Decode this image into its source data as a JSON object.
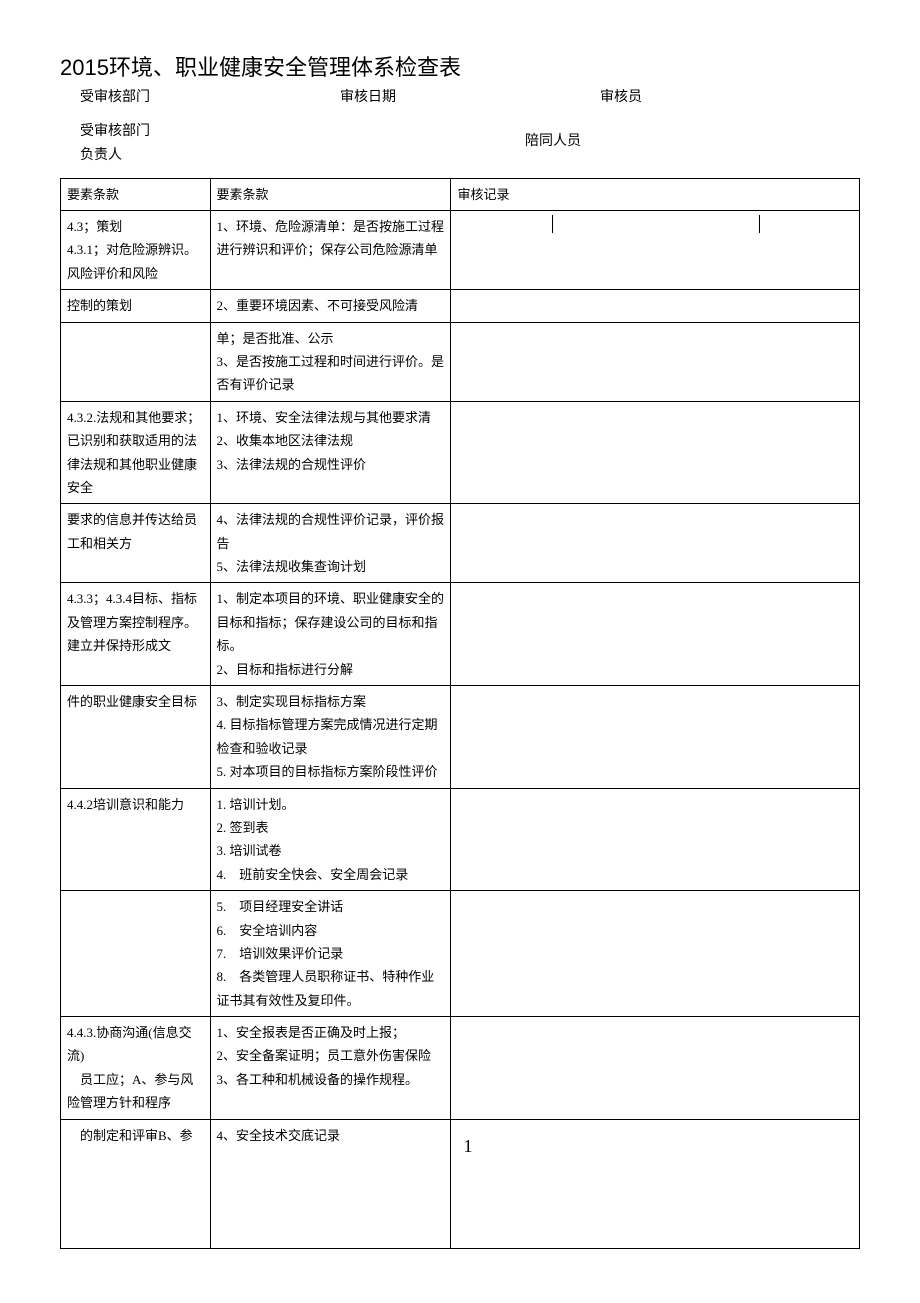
{
  "title": "2015环境、职业健康安全管理体系检查表",
  "header": {
    "dept_audited_label": "受审核部门",
    "audit_date_label": "审核日期",
    "auditor_label": "审核员",
    "dept_head_label_line1": "受审核部门",
    "dept_head_label_line2": "负责人",
    "accompany_label": "陪同人员"
  },
  "table": {
    "head": {
      "col1": "要素条款",
      "col2": "要素条款",
      "col3": "审核记录"
    },
    "page_number": "1",
    "rows": [
      {
        "c1": "4.3；策划\n4.3.1；对危险源辨识。风险评价和风险",
        "c2": "1、环境、危险源清单：是否按施工过程进行辨识和评价；保存公司危险源清单",
        "split3": true
      },
      {
        "c1": "控制的策划",
        "c2": "2、重要环境因素、不可接受风险清",
        "split3": false
      },
      {
        "c1": "",
        "c2": "单；是否批准、公示\n3、是否按施工过程和时间进行评价。是否有评价记录",
        "split3": false
      },
      {
        "c1": "4.3.2.法规和其他要求；已识别和获取适用的法律法规和其他职业健康安全",
        "c2": "1、环境、安全法律法规与其他要求清\n2、收集本地区法律法规\n3、法律法规的合规性评价",
        "split3": false
      },
      {
        "c1": "要求的信息并传达给员工和相关方",
        "c2": "4、法律法规的合规性评价记录，评价报告\n5、法律法规收集查询计划",
        "split3": false
      },
      {
        "c1": "4.3.3；4.3.4目标、指标及管理方案控制程序。\n建立并保持形成文",
        "c2": "1、制定本项目的环境、职业健康安全的目标和指标；保存建设公司的目标和指标。\n2、目标和指标进行分解",
        "split3": false
      },
      {
        "c1": "件的职业健康安全目标",
        "c2": "3、制定实现目标指标方案\n4. 目标指标管理方案完成情况进行定期检查和验收记录\n5. 对本项目的目标指标方案阶段性评价",
        "split3": false
      },
      {
        "c1": "4.4.2培训意识和能力",
        "c2": "1. 培训计划。\n2. 签到表\n3. 培训试卷\n4.　班前安全快会、安全周会记录",
        "split3": false
      },
      {
        "c1": "",
        "c2": "5.　项目经理安全讲话\n6.　安全培训内容\n7.　培训效果评价记录\n8.　各类管理人员职称证书、特种作业证书其有效性及复印件。",
        "split3": false
      },
      {
        "c1": "4.4.3.协商沟通(信息交流)\n　员工应；A、参与风险管理方针和程序",
        "c2": "1、安全报表是否正确及时上报；\n2、安全备案证明；员工意外伤害保险\n3、各工种和机械设备的操作规程。",
        "split3": false
      },
      {
        "c1": "　的制定和评审B、参",
        "c2": "4、安全技术交底记录",
        "split3": false,
        "page": true
      }
    ]
  }
}
